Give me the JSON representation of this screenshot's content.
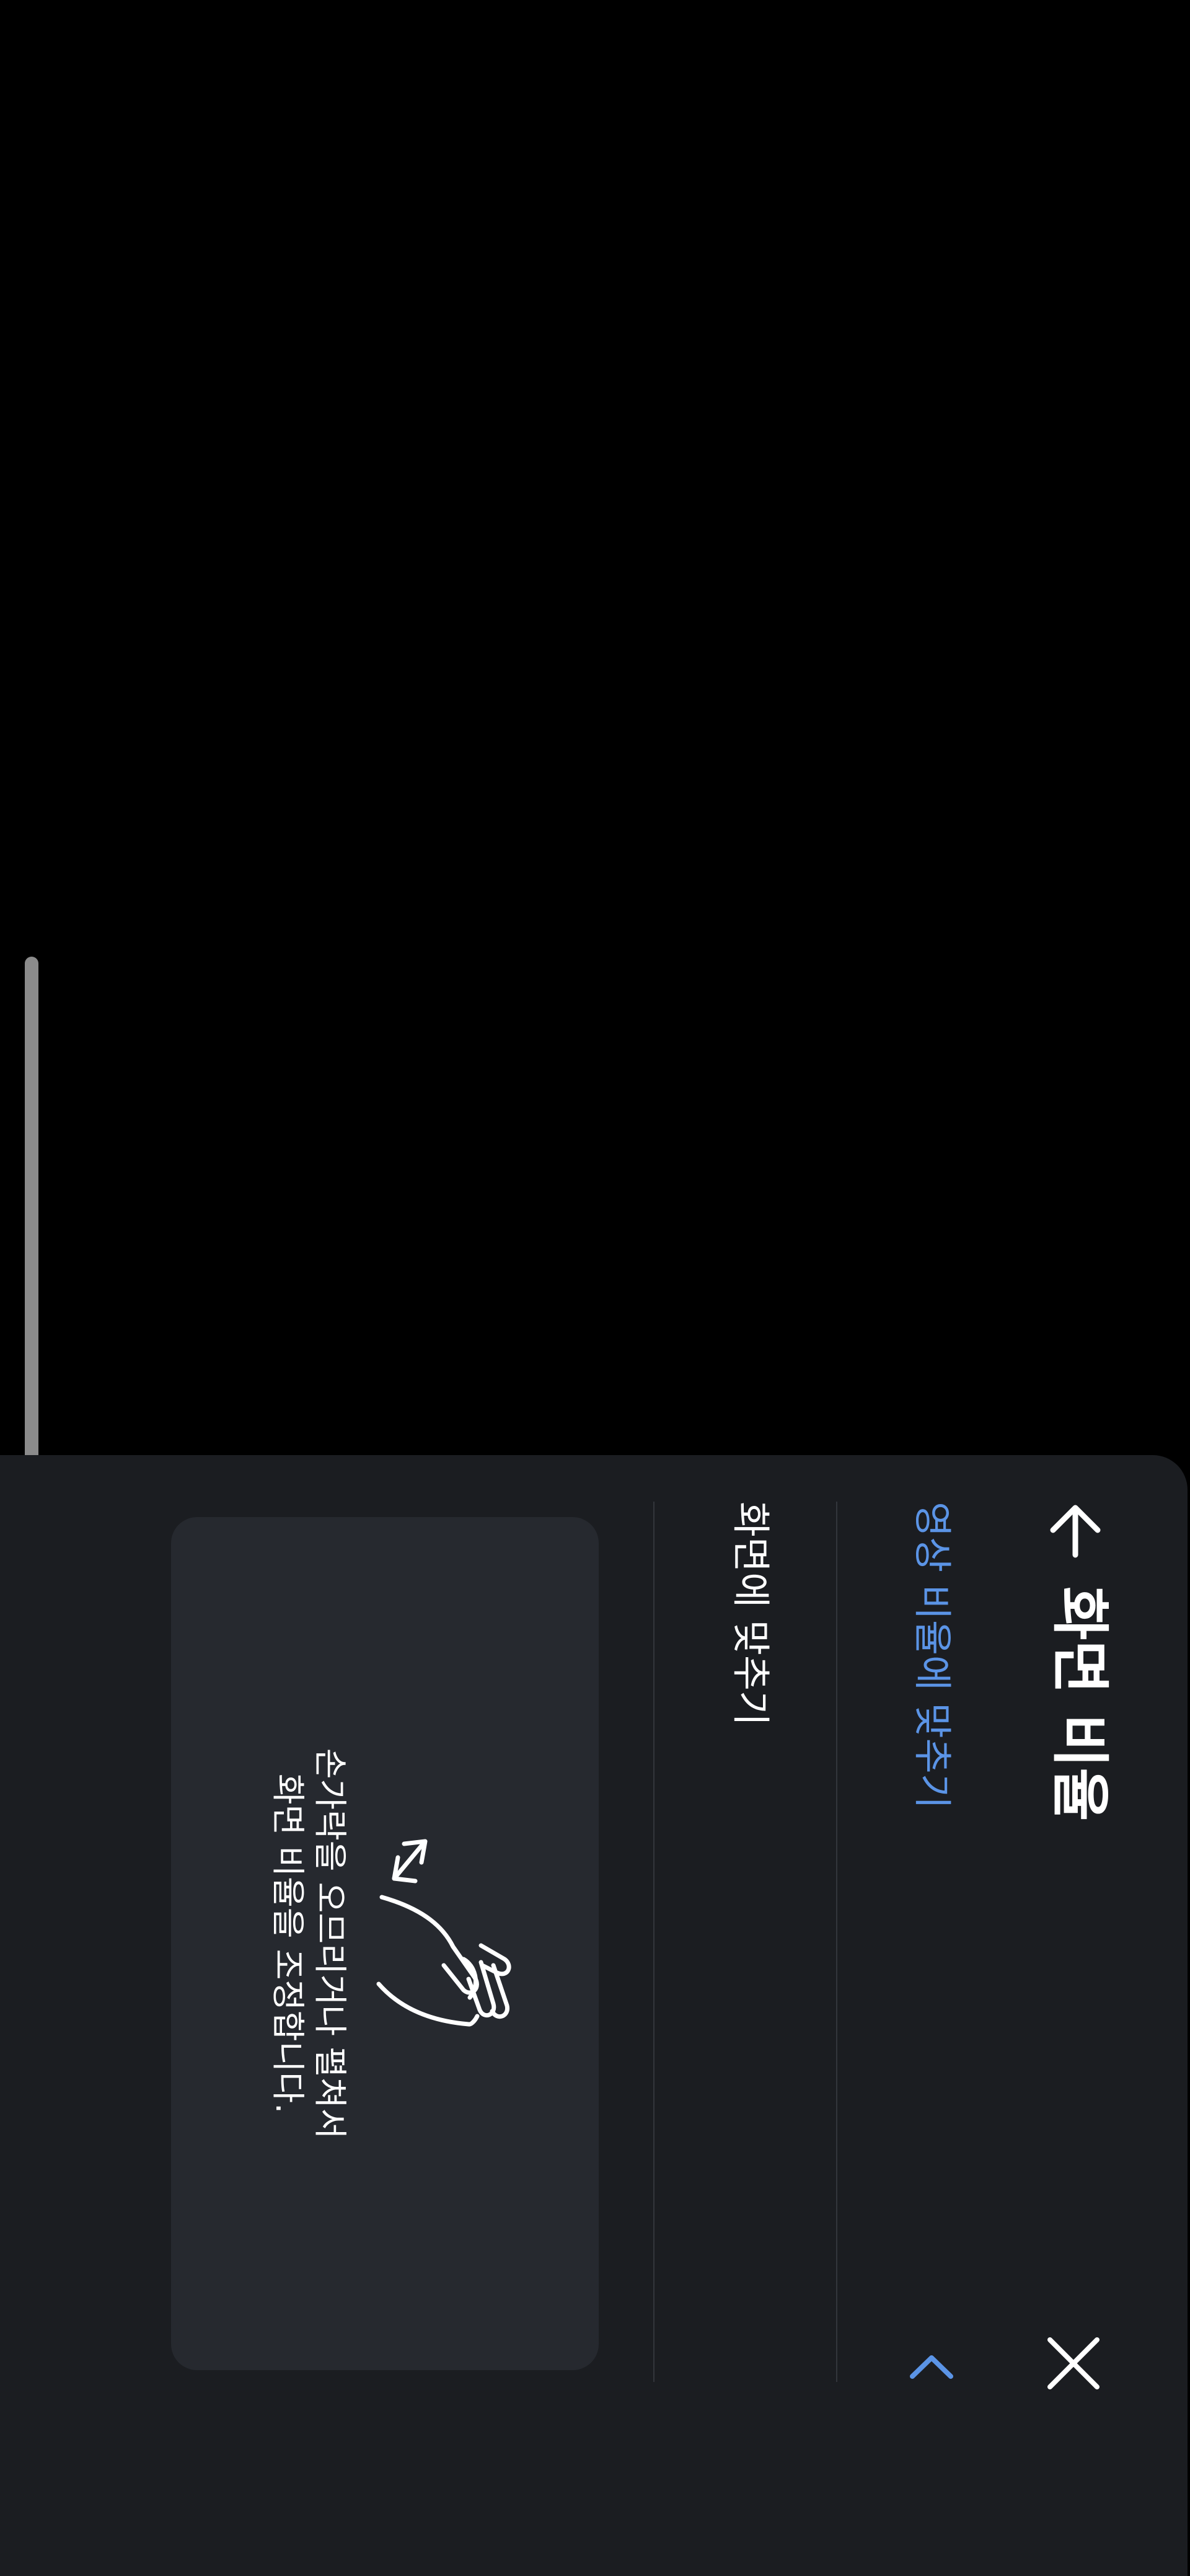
{
  "header": {
    "title": "화면 비율",
    "back_icon": "arrow-left-icon",
    "close_icon": "close-icon"
  },
  "options": [
    {
      "label": "영상 비율에 맞추기",
      "selected": true,
      "color": "#5b94e6",
      "icon": "chevron-left-icon"
    },
    {
      "label": "화면에 맞추기",
      "selected": false,
      "color": "#ffffff"
    }
  ],
  "hint": {
    "icon": "pinch-gesture-icon",
    "line1": "손가락을 오므리거나 펼쳐서",
    "line2": "화면 비율을 조정합니다."
  },
  "colors": {
    "panel_bg": "#1b1d21",
    "card_bg": "#26292f",
    "accent": "#5b94e6",
    "background": "#000000"
  }
}
